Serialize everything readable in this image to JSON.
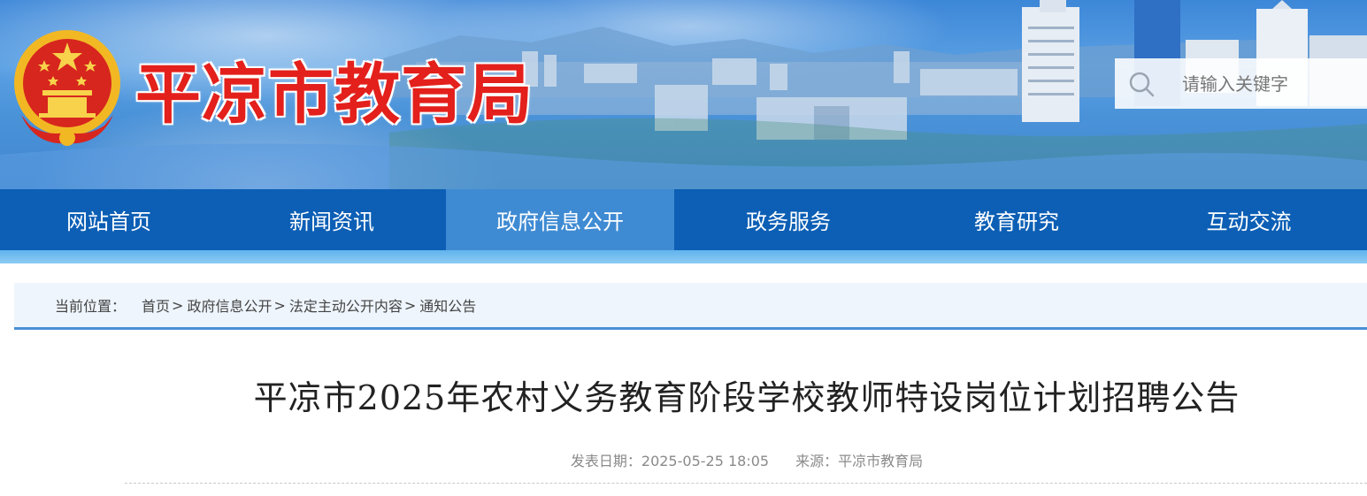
{
  "site": {
    "title": "平凉市教育局"
  },
  "search": {
    "placeholder": "请输入关键字"
  },
  "nav": {
    "items": [
      {
        "label": "网站首页"
      },
      {
        "label": "新闻资讯"
      },
      {
        "label": "政府信息公开",
        "active": true
      },
      {
        "label": "政务服务"
      },
      {
        "label": "教育研究"
      },
      {
        "label": "互动交流"
      }
    ]
  },
  "breadcrumb": {
    "label": "当前位置：",
    "items": [
      "首页",
      "政府信息公开",
      "法定主动公开内容",
      "通知公告"
    ],
    "separator": ">"
  },
  "article": {
    "title": "平凉市2025年农村义务教育阶段学校教师特设岗位计划招聘公告",
    "date_label": "发表日期：",
    "date": "2025-05-25 18:05",
    "source_label": "来源：",
    "source": "平凉市教育局"
  },
  "colors": {
    "nav_bg": "#0c5fb5",
    "nav_active": "#3f8bd3",
    "title_red": "#e3201b",
    "breadcrumb_border": "#4a90d6"
  },
  "icons": {
    "emblem": "national-emblem-icon",
    "search": "search-icon"
  }
}
